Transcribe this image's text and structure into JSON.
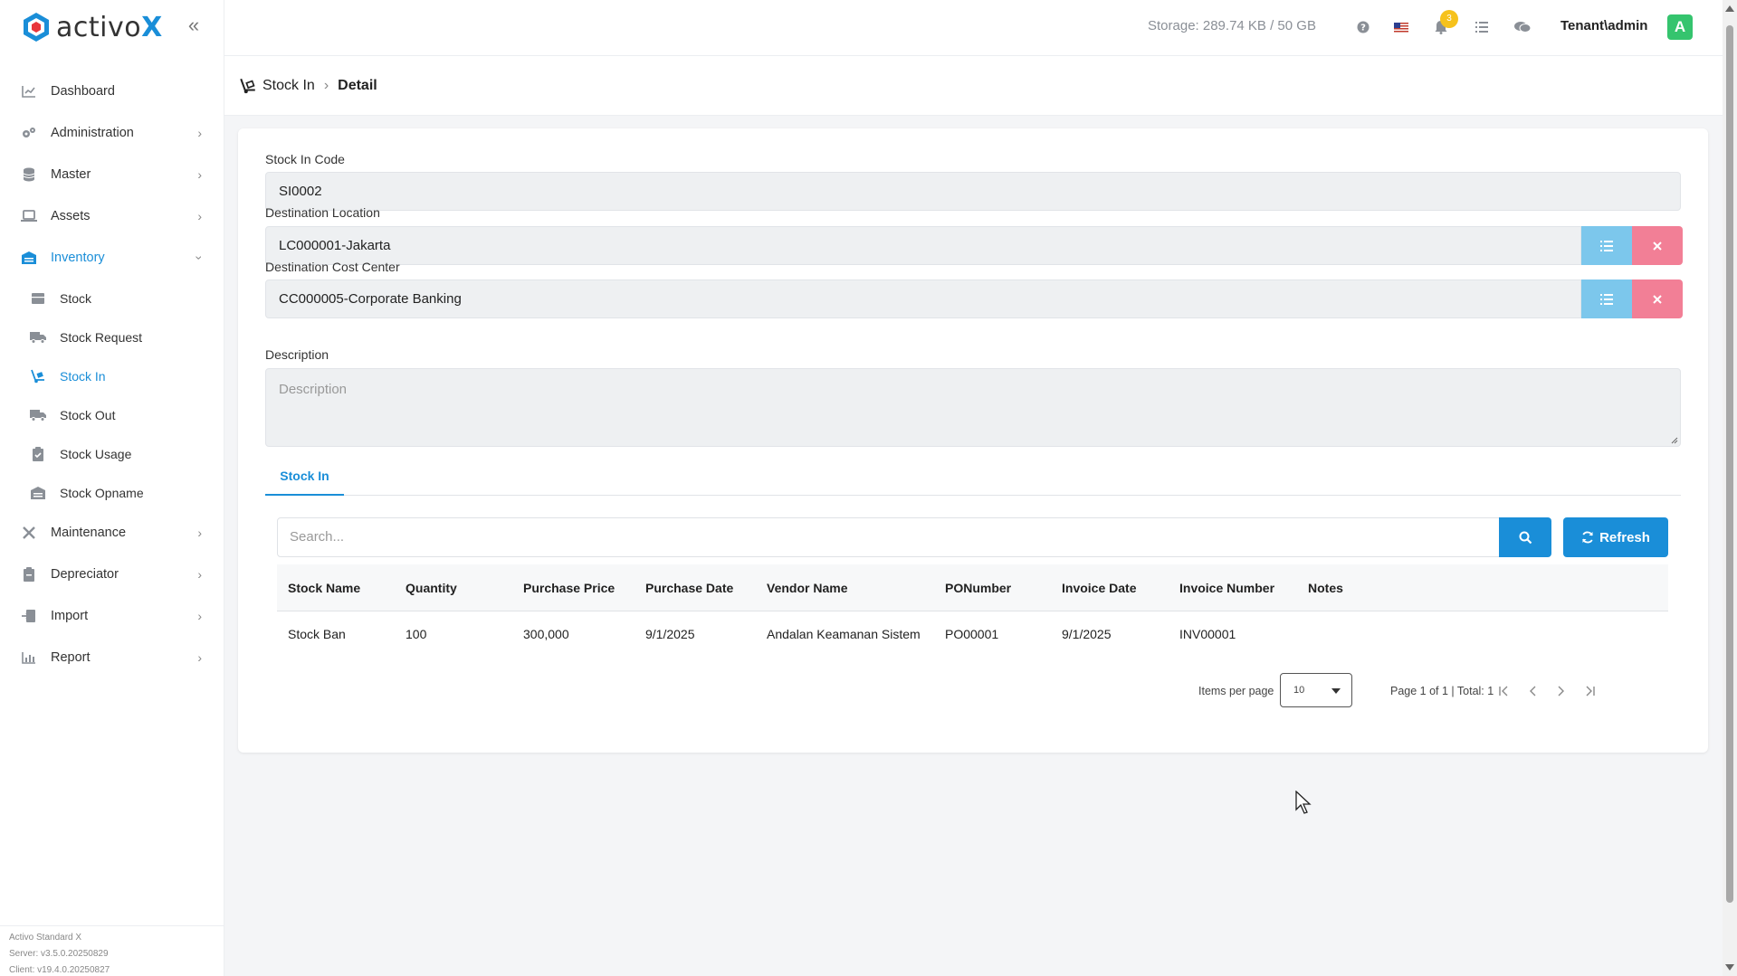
{
  "brand": {
    "name": "activo",
    "suffix": "X",
    "accent": "#1a8ed8"
  },
  "sidebar": {
    "items": [
      {
        "label": "Dashboard",
        "icon": "chart-line-icon"
      },
      {
        "label": "Administration",
        "icon": "gears-icon"
      },
      {
        "label": "Master",
        "icon": "database-icon"
      },
      {
        "label": "Assets",
        "icon": "laptop-icon"
      },
      {
        "label": "Inventory",
        "icon": "warehouse-icon"
      }
    ],
    "subitems": [
      {
        "label": "Stock",
        "icon": "box-icon"
      },
      {
        "label": "Stock Request",
        "icon": "truck-icon"
      },
      {
        "label": "Stock In",
        "icon": "dolly-icon"
      },
      {
        "label": "Stock Out",
        "icon": "truck-moving-icon"
      },
      {
        "label": "Stock Usage",
        "icon": "clipboard-check-icon"
      },
      {
        "label": "Stock Opname",
        "icon": "warehouse-icon"
      }
    ],
    "items_after": [
      {
        "label": "Maintenance",
        "icon": "tools-icon"
      },
      {
        "label": "Depreciator",
        "icon": "clipboard-icon"
      },
      {
        "label": "Import",
        "icon": "file-import-icon"
      },
      {
        "label": "Report",
        "icon": "chart-bar-icon"
      }
    ],
    "footer": {
      "line1": "Activo Standard X",
      "line2": "Server: v3.5.0.20250829",
      "line3": "Client: v19.4.0.20250827"
    }
  },
  "header": {
    "storage": "Storage: 289.74 KB / 50 GB",
    "notifications_count": "3",
    "user": "Tenant\\admin",
    "avatar_letter": "A"
  },
  "breadcrumb": {
    "section": "Stock In",
    "current": "Detail"
  },
  "form": {
    "stock_in_code_label": "Stock In Code",
    "stock_in_code": "SI0002",
    "destination_location_label": "Destination Location",
    "destination_location": "LC000001-Jakarta",
    "destination_cost_center_label": "Destination Cost Center",
    "destination_cost_center": "CC000005-Corporate Banking",
    "description_label": "Description",
    "description_placeholder": "Description"
  },
  "tabs": [
    {
      "label": "Stock In"
    }
  ],
  "search": {
    "placeholder": "Search...",
    "refresh_label": "Refresh"
  },
  "table": {
    "columns": [
      "Stock Name",
      "Quantity",
      "Purchase Price",
      "Purchase Date",
      "Vendor Name",
      "PONumber",
      "Invoice Date",
      "Invoice Number",
      "Notes"
    ],
    "rows": [
      [
        "Stock Ban",
        "100",
        "300,000",
        "9/1/2025",
        "Andalan Keamanan Sistem",
        "PO00001",
        "9/1/2025",
        "INV00001",
        ""
      ]
    ]
  },
  "pager": {
    "items_per_page_label": "Items per page",
    "page_size": "10",
    "info": "Page 1 of 1 | Total: 1"
  }
}
